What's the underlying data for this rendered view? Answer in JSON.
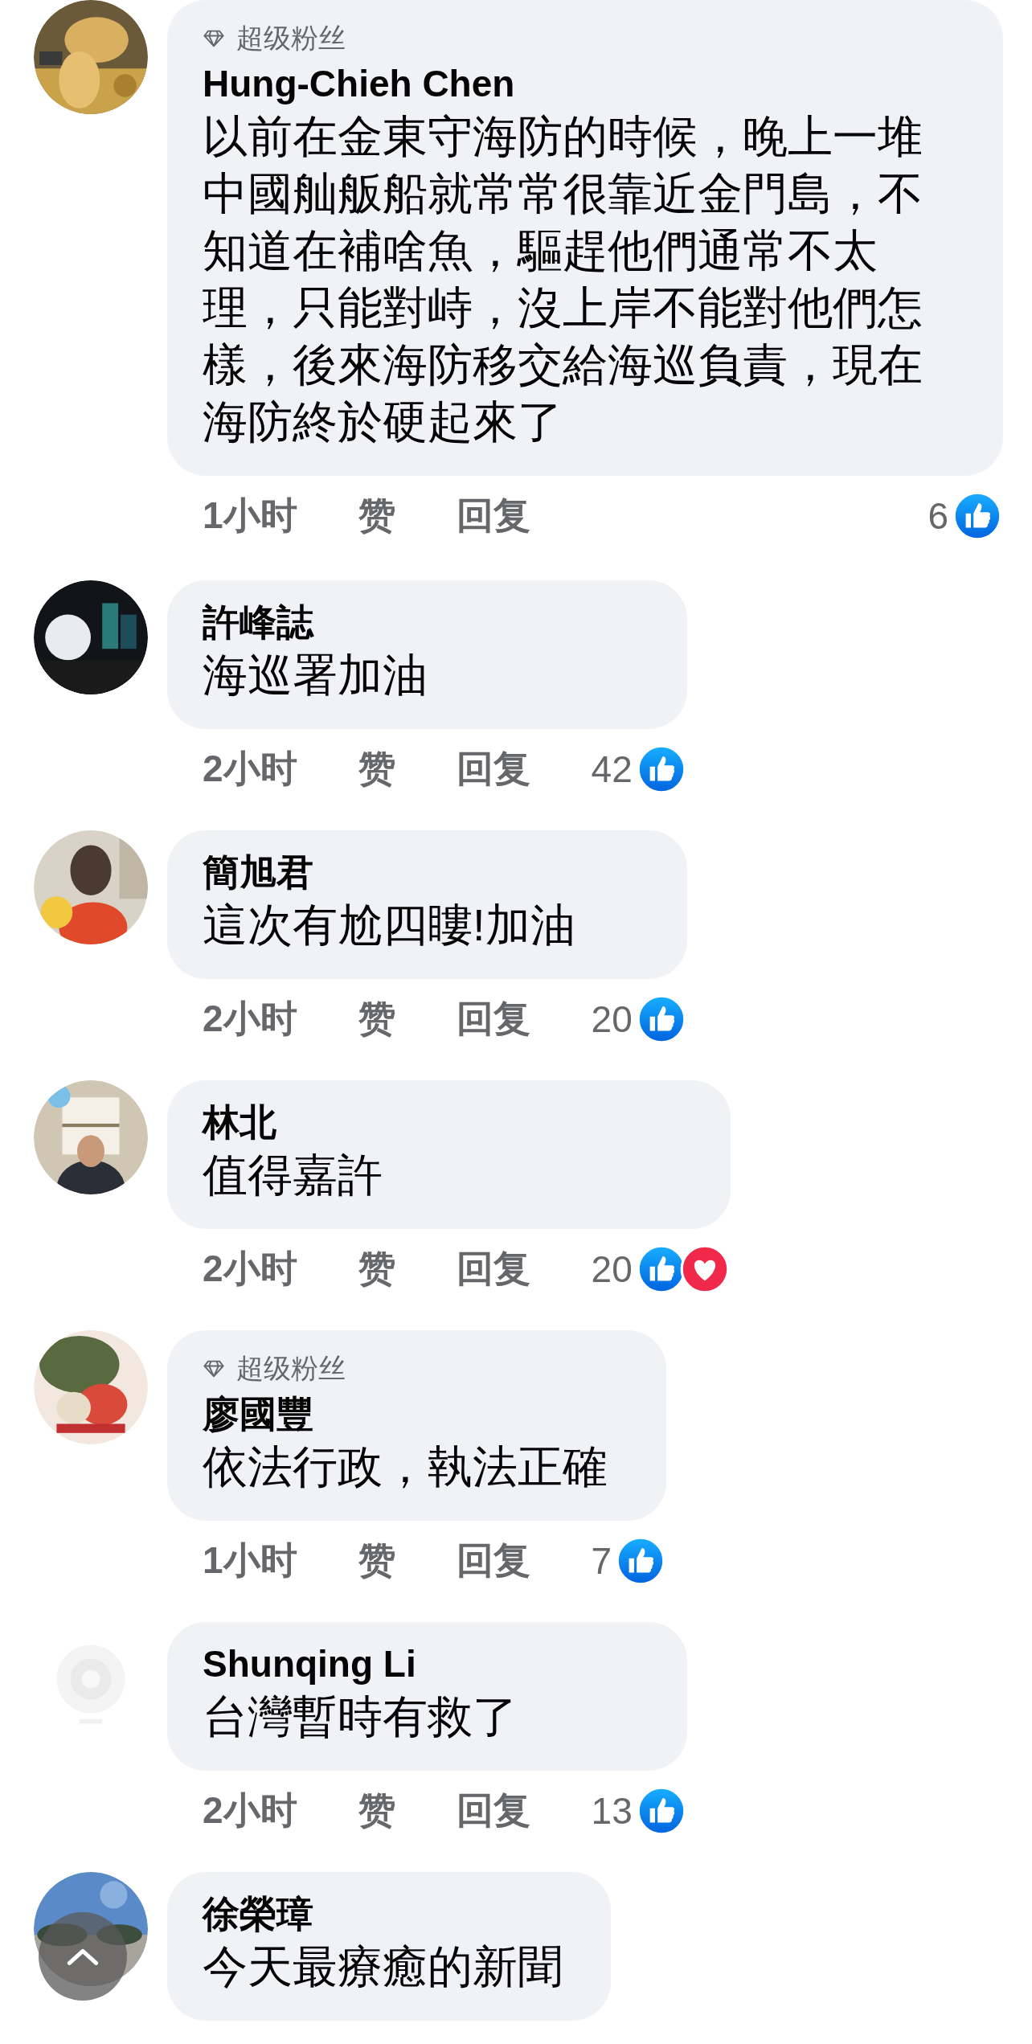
{
  "comments": [
    {
      "badge": "超级粉丝",
      "name": "Hung-Chieh Chen",
      "text": "以前在金東守海防的時候，晚上一堆中國舢舨船就常常很靠近金門島，不知道在補啥魚，驅趕他們通常不太理，只能對峙，沒上岸不能對他們怎樣，後來海防移交給海巡負責，現在海防終於硬起來了",
      "time": "1小时",
      "like": "赞",
      "reply": "回复",
      "reactions": {
        "count": "6",
        "icons": [
          {
            "kind": "like"
          }
        ]
      }
    },
    {
      "name": "許峰誌",
      "text": "海巡署加油",
      "time": "2小时",
      "like": "赞",
      "reply": "回复",
      "reactions": {
        "count": "42",
        "icons": [
          {
            "kind": "like"
          }
        ]
      }
    },
    {
      "name": "簡旭君",
      "text": "這次有尬四瞜!加油",
      "time": "2小时",
      "like": "赞",
      "reply": "回复",
      "reactions": {
        "count": "20",
        "icons": [
          {
            "kind": "like"
          }
        ]
      }
    },
    {
      "name": "林北",
      "text": "值得嘉許",
      "time": "2小时",
      "like": "赞",
      "reply": "回复",
      "reactions": {
        "count": "20",
        "icons": [
          {
            "kind": "like"
          },
          {
            "kind": "heart"
          }
        ]
      }
    },
    {
      "badge": "超级粉丝",
      "name": "廖國豐",
      "text": "依法行政，執法正確",
      "time": "1小时",
      "like": "赞",
      "reply": "回复",
      "reactions": {
        "count": "7",
        "icons": [
          {
            "kind": "like"
          }
        ]
      }
    },
    {
      "name": "Shunqing Li",
      "text": "台灣暫時有救了",
      "time": "2小时",
      "like": "赞",
      "reply": "回复",
      "reactions": {
        "count": "13",
        "icons": [
          {
            "kind": "like"
          }
        ]
      }
    },
    {
      "name": "徐榮璋",
      "text": "今天最療癒的新聞"
    }
  ]
}
